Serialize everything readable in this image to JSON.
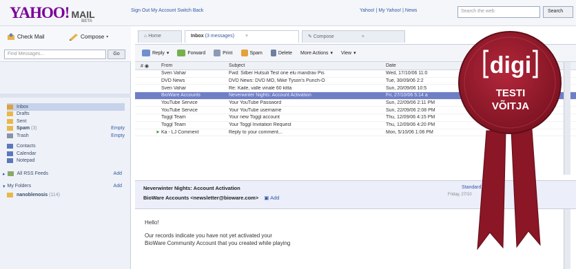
{
  "header": {
    "logo_text": "YAHOO!",
    "logo_mail": "MAIL",
    "logo_beta": "BETA",
    "top_links": "Sign Out  My Account  Switch Back",
    "right_links": "Yahoo!  |  My Yahoo!  |  News",
    "search_placeholder": "Search the web",
    "search_button": "Search"
  },
  "sidebar": {
    "check_mail": "Check Mail",
    "compose": "Compose",
    "find_placeholder": "Find Messages...",
    "find_button": "Go",
    "folders": [
      {
        "label": "Inbox",
        "icon": "inbox-icon",
        "color": "#e0a040"
      },
      {
        "label": "Drafts",
        "icon": "drafts-icon",
        "color": "#e8b84a"
      },
      {
        "label": "Sent",
        "icon": "sent-icon",
        "color": "#e8b84a"
      },
      {
        "label": "Spam",
        "count": "(3)",
        "icon": "spam-icon",
        "color": "#e8b84a",
        "action": "Empty"
      },
      {
        "label": "Trash",
        "icon": "trash-icon",
        "color": "#8a93a6",
        "action": "Empty"
      }
    ],
    "tools": [
      {
        "label": "Contacts",
        "icon": "contacts-icon",
        "color": "#5b78b8"
      },
      {
        "label": "Calendar",
        "icon": "calendar-icon",
        "color": "#5b78b8"
      },
      {
        "label": "Notepad",
        "icon": "notepad-icon",
        "color": "#5b78b8"
      }
    ],
    "rss": {
      "label": "All RSS Feeds",
      "edit": "Add"
    },
    "my_folders": {
      "label": "My Folders",
      "edit": "Add"
    },
    "custom_folder": {
      "label": "nanoblenosis",
      "count": "(114)"
    }
  },
  "tabs": [
    {
      "label": "Home"
    },
    {
      "label": "Inbox",
      "extra": "(3 messages)"
    },
    {
      "label": "Compose"
    }
  ],
  "toolbar": {
    "reply": "Reply",
    "forward": "Forward",
    "print": "Print",
    "spam": "Spam",
    "delete": "Delete",
    "more_actions": "More Actions",
    "view": "View"
  },
  "list_headers": {
    "from": "From",
    "subject": "Subject",
    "date": "Date"
  },
  "messages": [
    {
      "from": "Sven Vahar",
      "subject": "Fwd: Silber Hutsuli Test one elu mandrav Pis",
      "date": "Wed, 17/10/06 11:0"
    },
    {
      "from": "DVD News",
      "subject": "DVD News: DVD MO, Mike Tyson's Punch-O",
      "date": "Tue, 30/09/06 2:2"
    },
    {
      "from": "Sven Vahar",
      "subject": "Re: Kaile, valle vinale 60 kitta",
      "date": "Sun, 20/09/06 10:5"
    },
    {
      "from": "BioWare Accounts",
      "subject": "Neverwinter Nights: Account Activation",
      "date": "Fri, 27/10/06 5:14 a",
      "selected": true
    },
    {
      "from": "YouTube Service",
      "subject": "Your YouTube Password",
      "date": "Sun, 22/09/06 2:11 PM"
    },
    {
      "from": "YouTube Service",
      "subject": "Your YouTube username",
      "date": "Sun, 22/09/06 2:08 PM"
    },
    {
      "from": "Toggl Team",
      "subject": "Your new Toggl account",
      "date": "Thu, 12/09/06 4:15 PM"
    },
    {
      "from": "Toggl Team",
      "subject": "Your Toggl Invitation Request",
      "date": "Thu, 12/09/06 4:20 PM"
    },
    {
      "from": "Ka - LJ Comment",
      "subject": "Reply to your comment...",
      "date": "Mon, 5/10/06 1:06 PM"
    }
  ],
  "preview": {
    "subject": "Neverwinter Nights: Account Activation",
    "from_name": "BioWare Accounts",
    "from_email": "<newsletter@bioware.com>",
    "add": "Add",
    "standard": "Standard",
    "date": "Friday, 27/10",
    "greeting": "Hello!",
    "line1": "Our records indicate you have not yet activated your",
    "line2": "BioWare Community Account that you created while playing"
  },
  "badge": {
    "brand": "digi",
    "line1": "TESTI",
    "line2": "VÕITJA",
    "color": "#9b1b2a"
  }
}
